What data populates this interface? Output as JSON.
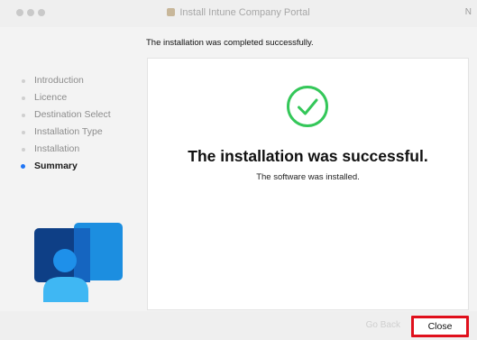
{
  "window": {
    "title": "Install Intune Company Portal",
    "edge_glyph": "N"
  },
  "status_message": "The installation was completed successfully.",
  "sidebar": {
    "steps": [
      {
        "label": "Introduction",
        "active": false
      },
      {
        "label": "Licence",
        "active": false
      },
      {
        "label": "Destination Select",
        "active": false
      },
      {
        "label": "Installation Type",
        "active": false
      },
      {
        "label": "Installation",
        "active": false
      },
      {
        "label": "Summary",
        "active": true
      }
    ]
  },
  "main": {
    "headline": "The installation was successful.",
    "subline": "The software was installed."
  },
  "footer": {
    "go_back_label": "Go Back",
    "close_label": "Close"
  },
  "colors": {
    "success_green": "#34c759",
    "active_step_blue": "#1f75f5",
    "highlight_red": "#e0101c"
  },
  "icons": {
    "success": "checkmark-circle-icon",
    "app_logo": "company-portal-logo-icon"
  }
}
